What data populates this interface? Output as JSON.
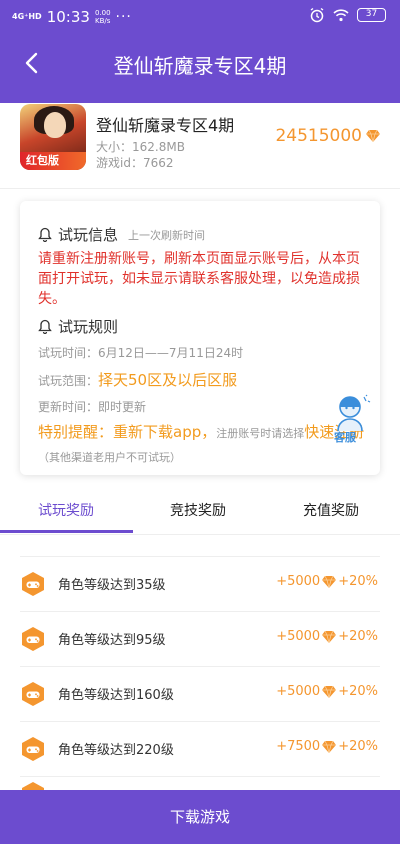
{
  "status_bar": {
    "signal": "4G⁺HD",
    "time": "10:33",
    "net_speed_value": "0.00",
    "net_speed_unit": "KB/s",
    "more": "···",
    "battery": "37"
  },
  "header": {
    "title": "登仙斩魔录专区4期"
  },
  "game": {
    "name": "登仙斩魔录专区4期",
    "size_label": "大小：",
    "size_value": "162.8MB",
    "id_label": "游戏id：",
    "id_value": "7662",
    "badge": "红包版",
    "coins": "24515000"
  },
  "trial_info": {
    "title": "试玩信息",
    "subtitle": "上一次刷新时间",
    "warning": "请重新注册新账号，刷新本页面显示账号后，从本页面打开试玩，如未显示请联系客服处理，以免造成损失。"
  },
  "trial_rules": {
    "title": "试玩规则",
    "time_label": "试玩时间：",
    "time_value": "6月12日——7月11日24时",
    "range_label": "试玩范围：",
    "range_value": "择天50区及以后区服",
    "update_label": "更新时间：",
    "update_value": "即时更新",
    "notice_prefix": "特别提醒：重新下载app，",
    "notice_small": "注册账号时请选择",
    "notice_fast": "快速注册",
    "notice_tail": "（其他渠道老用户不可试玩）",
    "customer_service": "客服"
  },
  "tabs": [
    {
      "label": "试玩奖励",
      "active": true
    },
    {
      "label": "竞技奖励",
      "active": false
    },
    {
      "label": "充值奖励",
      "active": false
    }
  ],
  "rewards": [
    {
      "label": "角色等级达到35级",
      "coins": "+5000",
      "bonus": "+20%"
    },
    {
      "label": "角色等级达到95级",
      "coins": "+5000",
      "bonus": "+20%"
    },
    {
      "label": "角色等级达到160级",
      "coins": "+5000",
      "bonus": "+20%"
    },
    {
      "label": "角色等级达到220级",
      "coins": "+7500",
      "bonus": "+20%"
    }
  ],
  "download_button": "下载游戏",
  "colors": {
    "brand": "#6c4ccf",
    "accent_orange": "#f4962f",
    "warning_red": "#e0322c"
  }
}
